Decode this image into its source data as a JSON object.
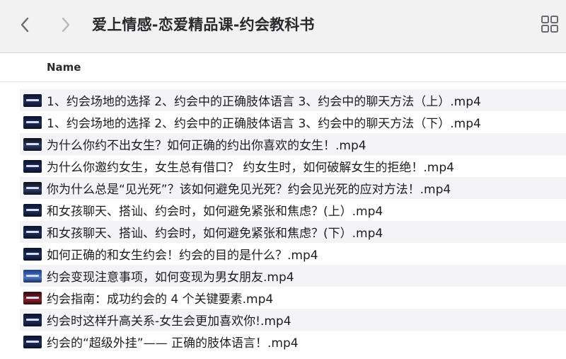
{
  "window": {
    "title": "爱上情感-恋爱精品课-约会教科书"
  },
  "toolbar": {
    "back_icon": "chevron-left-icon",
    "forward_icon": "chevron-right-icon",
    "view_icon": "grid-view-icon"
  },
  "columns": {
    "name": "Name"
  },
  "files": [
    {
      "name": "1、约会场地的选择 2、约会中的正确肢体语言 3、约会中的聊天方法（上）.mp4",
      "thumb": "dark"
    },
    {
      "name": "1、约会场地的选择 2、约会中的正确肢体语言 3、约会中的聊天方法（下）.mp4",
      "thumb": "dark"
    },
    {
      "name": "为什么你约不出女生？如何正确的约出你喜欢的女生！.mp4",
      "thumb": "dark2"
    },
    {
      "name": "为什么你邀约女生，女生总有借口？ 约女生时，如何破解女生的拒绝！.mp4",
      "thumb": "dark"
    },
    {
      "name": "你为什么总是“见光死”？该如何避免见光死？约会见光死的应对方法！.mp4",
      "thumb": "dark2"
    },
    {
      "name": "和女孩聊天、搭讪、约会时，如何避免紧张和焦虑？(上）.mp4",
      "thumb": "dark"
    },
    {
      "name": "和女孩聊天、搭讪、约会时，如何避免紧张和焦虑？(下）.mp4",
      "thumb": "dark"
    },
    {
      "name": "如何正确的和女生约会！约会的目的是什么？.mp4",
      "thumb": "dark"
    },
    {
      "name": "约会变现注意事项，如何变现为男女朋友.mp4",
      "thumb": "blue"
    },
    {
      "name": "约会指南：成功约会的 4 个关键要素.mp4",
      "thumb": "red"
    },
    {
      "name": "约会时这样升高关系-女生会更加喜欢你!.mp4",
      "thumb": "dark"
    },
    {
      "name": "约会的“超级外挂”—— 正确的肢体语言！.mp4",
      "thumb": "dark"
    }
  ]
}
